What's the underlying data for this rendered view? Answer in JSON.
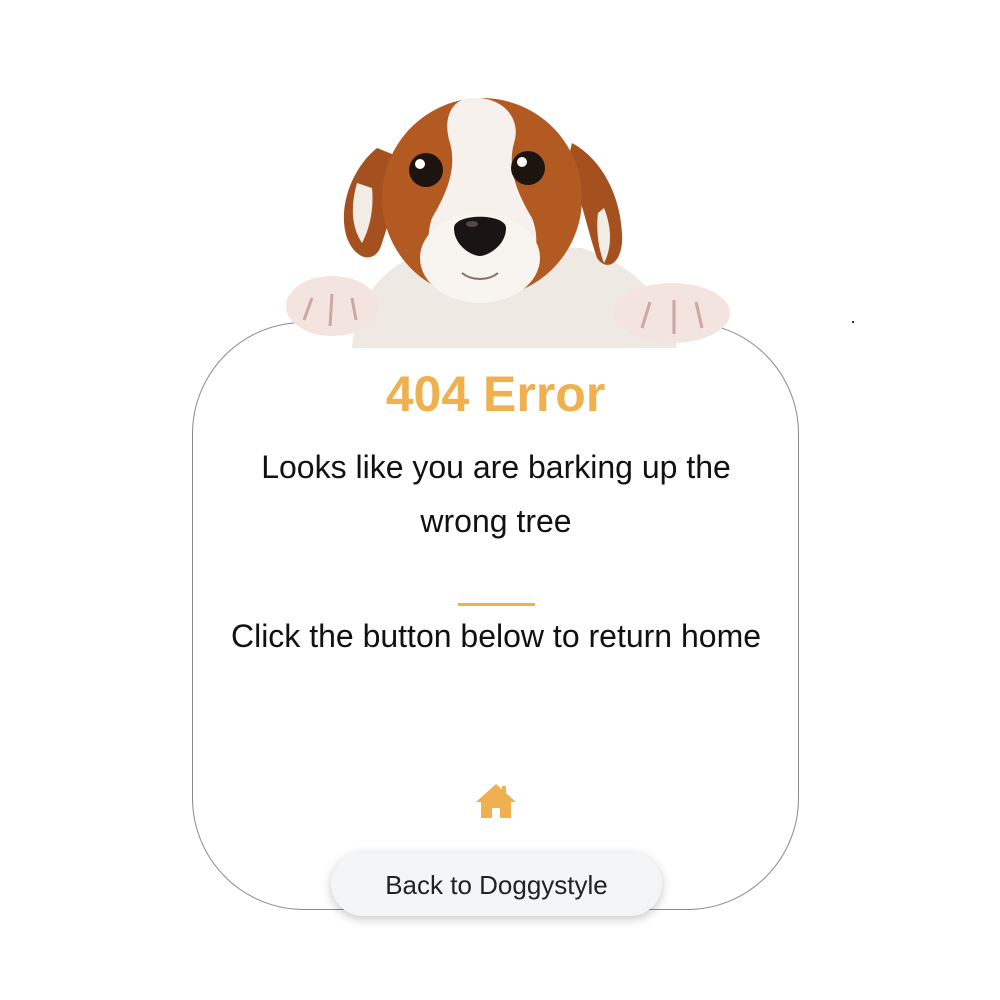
{
  "error": {
    "title": "404 Error",
    "message_line": "Looks like you are barking up the wrong tree",
    "instruction": "Click the button below to return home"
  },
  "actions": {
    "back_button_label": "Back to Doggystyle",
    "home_icon": "home-icon"
  },
  "illustration": {
    "subject": "puppy-peeking-over-card"
  },
  "colors": {
    "accent": "#efb04f",
    "text": "#111111",
    "button_bg": "#f4f5f7",
    "card_border": "#8a8a8a"
  }
}
